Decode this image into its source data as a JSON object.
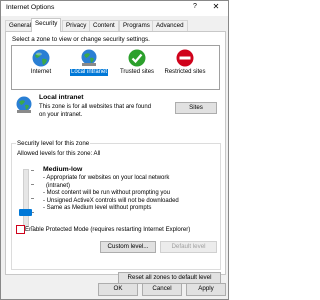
{
  "window": {
    "title": "Internet Options",
    "help_label": "?",
    "close_label": "✕"
  },
  "tabs": [
    {
      "label": "General",
      "active": false
    },
    {
      "label": "Security",
      "active": true
    },
    {
      "label": "Privacy",
      "active": false
    },
    {
      "label": "Content",
      "active": false
    },
    {
      "label": "Programs",
      "active": false
    },
    {
      "label": "Advanced",
      "active": false
    }
  ],
  "security": {
    "zone_prompt": "Select a zone to view or change security settings.",
    "zones": [
      {
        "label": "Internet",
        "icon": "globe-icon",
        "selected": false
      },
      {
        "label": "Local intranet",
        "icon": "local-intranet-icon",
        "selected": true
      },
      {
        "label": "Trusted sites",
        "icon": "trusted-sites-icon",
        "selected": false
      },
      {
        "label": "Restricted sites",
        "icon": "restricted-sites-icon",
        "selected": false
      }
    ],
    "detail_title": "Local intranet",
    "detail_desc": "This zone is for all websites that are found on your intranet.",
    "sites_button": "Sites",
    "group_label": "Security level for this zone",
    "allowed_levels": "Allowed levels for this zone: All",
    "level_title": "Medium-low",
    "level_desc": [
      "- Appropriate for websites on your local network",
      "(intranet)",
      "- Most content will be run without prompting you",
      "- Unsigned ActiveX controls will not be downloaded",
      "- Same as Medium level without prompts"
    ],
    "protected_mode_label": "Enable Protected Mode (requires restarting Internet Explorer)",
    "protected_mode_checked": false,
    "custom_level_button": "Custom level...",
    "default_level_button": "Default level",
    "reset_button": "Reset all zones to default level",
    "slider_level": 2,
    "slider_levels_total": 5
  },
  "footer": {
    "ok": "OK",
    "cancel": "Cancel",
    "apply": "Apply"
  },
  "colors": {
    "accent": "#0078d7",
    "restricted": "#d0021b",
    "trusted": "#2ca02c"
  }
}
